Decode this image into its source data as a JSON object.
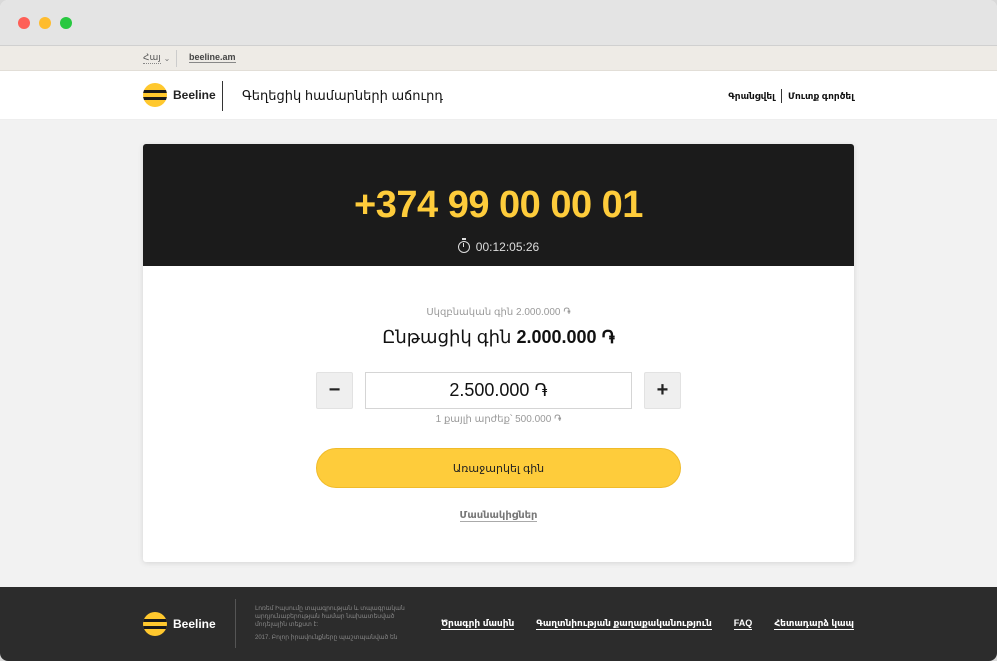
{
  "topbar": {
    "lang_label": "Հայ",
    "site_link": "beeline.am"
  },
  "header": {
    "logo_text": "Beeline",
    "title": "Գեղեցիկ համարների աճուրդ",
    "register": "Գրանցվել",
    "login": "Մուտք գործել"
  },
  "auction": {
    "phone": "+374 99 00 00 01",
    "timer": "00:12:05:26",
    "start_price": "Սկզբնական գին 2.000.000 ֏",
    "current_price_label": "Ընթացիկ գին",
    "current_price_value": "2.000.000 ֏",
    "minus_label": "−",
    "plus_label": "+",
    "bid_value": "2.500.000 ֏",
    "step_note": "1 քայլի արժեք՝ 500.000 ֏",
    "submit_label": "Առաջարկել գին",
    "participants_label": "Մասնակիցներ"
  },
  "footer": {
    "logo_text": "Beeline",
    "legal": "Լոռեմ Իպսումը տպագրության և տպագրական արդյունաբերության համար նախատեսված մոդելային տեքստ է:",
    "copyright": "2017. Բոլոր իրավունքները պաշտպանված են",
    "links": [
      "Ծրագրի մասին",
      "Գաղտնիության քաղաքականություն",
      "FAQ",
      "Հետադարձ կապ"
    ]
  },
  "colors": {
    "brand_yellow": "#fecc3b",
    "dark": "#1b1b1b",
    "footer_bg": "#2c2c2c"
  }
}
